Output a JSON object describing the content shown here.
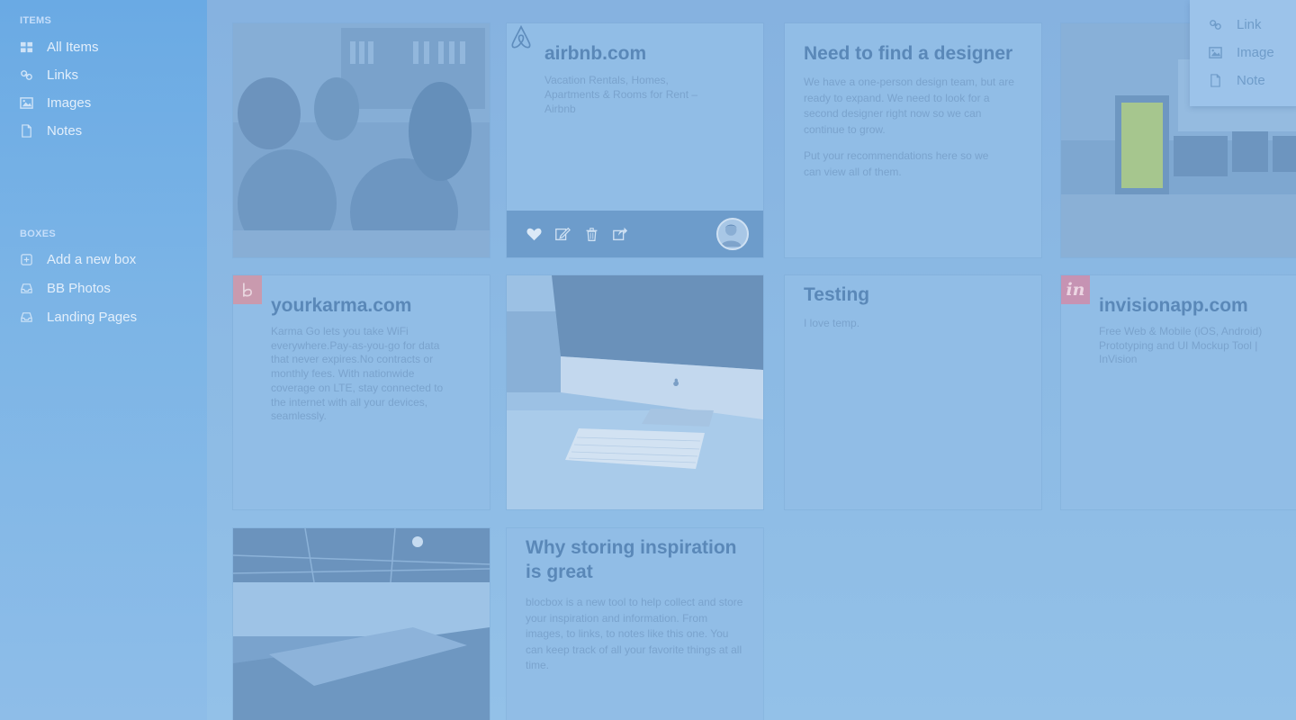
{
  "sidebar": {
    "items_heading": "ITEMS",
    "items": [
      {
        "label": "All Items",
        "icon": "grid-icon"
      },
      {
        "label": "Links",
        "icon": "link-icon"
      },
      {
        "label": "Images",
        "icon": "image-icon"
      },
      {
        "label": "Notes",
        "icon": "note-icon"
      }
    ],
    "boxes_heading": "BOXES",
    "boxes": [
      {
        "label": "Add a new box",
        "icon": "plus-icon"
      },
      {
        "label": "BB Photos",
        "icon": "inbox-icon"
      },
      {
        "label": "Landing Pages",
        "icon": "inbox-icon"
      }
    ]
  },
  "cards": {
    "airbnb": {
      "title": "airbnb.com",
      "description": "Vacation Rentals, Homes, Apartments & Rooms for Rent – Airbnb"
    },
    "designer_note": {
      "title": "Need to find a designer",
      "paragraph1": "We have a one-person design team, but are ready to expand. We need to look for a second designer right now so we can continue to grow.",
      "paragraph2": "Put your recommendations here so we can view all of them."
    },
    "yourkarma": {
      "title": "yourkarma.com",
      "description": "Karma Go lets you take WiFi everywhere.Pay-as-you-go for data that never expires.No contracts or monthly fees. With nationwide coverage on LTE, stay connected to the internet with all your devices, seamlessly."
    },
    "testing_note": {
      "title": "Testing",
      "body": "I love temp."
    },
    "invision": {
      "title": "invisionapp.com",
      "description": "Free Web & Mobile (iOS, Android) Prototyping and UI Mockup Tool | InVision"
    },
    "why_note": {
      "title": "Why storing inspiration is great",
      "body": "blocbox is a new tool to help collect and store your inspiration and information. From images, to links, to notes like this one. You can keep track of all your favorite things at all time."
    }
  },
  "dropdown": {
    "items": [
      {
        "label": "Link",
        "icon": "link-icon"
      },
      {
        "label": "Image",
        "icon": "image-icon"
      },
      {
        "label": "Note",
        "icon": "note-icon"
      }
    ]
  },
  "colors": {
    "sidebar_bg": "#6aaae4",
    "overlay_blue": "#8fb8e2",
    "title_blue": "#5a88b8"
  }
}
